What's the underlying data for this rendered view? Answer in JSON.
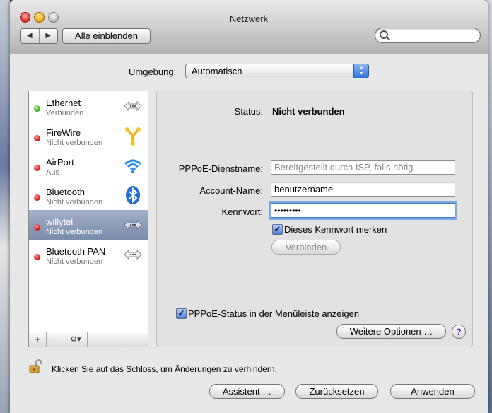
{
  "window": {
    "title": "Netzwerk"
  },
  "toolbar": {
    "back_label": "◀",
    "forward_label": "▶",
    "show_all_label": "Alle einblenden",
    "search_placeholder": ""
  },
  "location": {
    "label": "Umgebung:",
    "value": "Automatisch"
  },
  "services": [
    {
      "name": "Ethernet",
      "status": "Verbunden",
      "status_color": "green",
      "icon": "ethernet-arrows-icon"
    },
    {
      "name": "FireWire",
      "status": "Nicht verbunden",
      "status_color": "red",
      "icon": "firewire-icon"
    },
    {
      "name": "AirPort",
      "status": "Aus",
      "status_color": "red",
      "icon": "airport-wifi-icon"
    },
    {
      "name": "Bluetooth",
      "status": "Nicht verbunden",
      "status_color": "red",
      "icon": "bluetooth-icon"
    },
    {
      "name": "willytel",
      "status": "Nicht verbunden",
      "status_color": "red",
      "icon": "pppoe-arrows-icon",
      "selected": true
    },
    {
      "name": "Bluetooth PAN",
      "status": "Nicht verbunden",
      "status_color": "red",
      "icon": "bluetooth-pan-arrows-icon"
    }
  ],
  "list_footer": {
    "add": "+",
    "remove": "−",
    "gear": "⚙▾"
  },
  "detail": {
    "status_label": "Status:",
    "status_value": "Nicht verbunden",
    "service_name_label": "PPPoE-Dienstname:",
    "service_name_placeholder": "Bereitgestellt durch ISP, falls nötig",
    "account_label": "Account-Name:",
    "account_value": "benutzername",
    "password_label": "Kennwort:",
    "password_value": "•••••••••",
    "remember_label": "Dieses Kennwort merken",
    "remember_checked": true,
    "connect_label": "Verbinden",
    "show_status_label": "PPPoE-Status in der Menüleiste anzeigen",
    "show_status_checked": true,
    "advanced_label": "Weitere Optionen …",
    "help_label": "?"
  },
  "footer": {
    "lock_text": "Klicken Sie auf das Schloss, um Änderungen zu verhindern.",
    "assistant_label": "Assistent …",
    "revert_label": "Zurücksetzen",
    "apply_label": "Anwenden"
  },
  "colors": {
    "accent": "#2e6fd6",
    "selection": "#8393b0",
    "status_green": "#3fae22",
    "status_red": "#d82121"
  }
}
